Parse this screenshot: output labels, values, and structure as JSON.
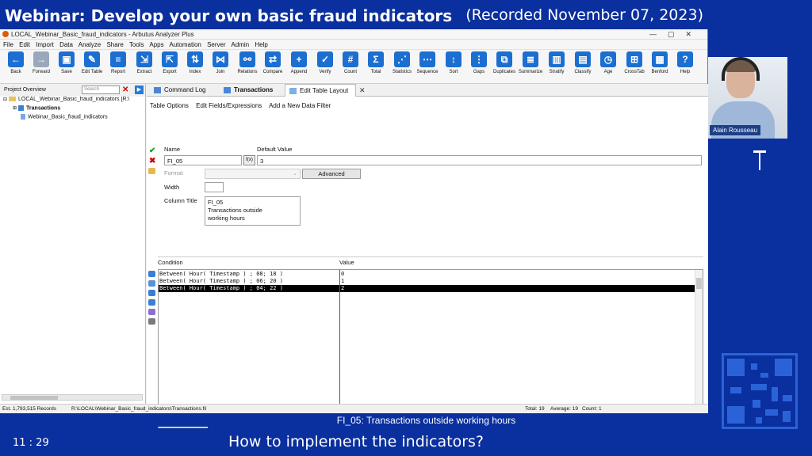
{
  "broadcast": {
    "title": "Webinar: Develop your own basic fraud indicators",
    "recorded": "(Recorded November 07, 2023)",
    "presenter": "Alain Rousseau",
    "time": "11 : 29",
    "caption": "FI_05: Transactions outside working hours",
    "subtitle": "How to implement the indicators?"
  },
  "window": {
    "title": "LOCAL_Webinar_Basic_fraud_indicators - Arbutus Analyzer Plus"
  },
  "menu": [
    "File",
    "Edit",
    "Import",
    "Data",
    "Analyze",
    "Share",
    "Tools",
    "Apps",
    "Automation",
    "Server",
    "Admin",
    "Help"
  ],
  "toolbar": [
    {
      "label": "Back",
      "icon": "back-arrow-icon",
      "color": "#1c6fd1",
      "glyph": "←"
    },
    {
      "label": "Forward",
      "icon": "forward-arrow-icon",
      "color": "#9aa8bb",
      "glyph": "→"
    },
    {
      "label": "Save",
      "icon": "save-icon",
      "color": "#1c6fd1",
      "glyph": "▣"
    },
    {
      "label": "Edit Table",
      "icon": "edit-table-icon",
      "color": "#1c6fd1",
      "glyph": "✎"
    },
    {
      "label": "Report",
      "icon": "report-icon",
      "color": "#1c6fd1",
      "glyph": "≡"
    },
    {
      "label": "Extract",
      "icon": "extract-icon",
      "color": "#1c6fd1",
      "glyph": "⇲"
    },
    {
      "label": "Export",
      "icon": "export-icon",
      "color": "#1c6fd1",
      "glyph": "⇱"
    },
    {
      "label": "Index",
      "icon": "index-icon",
      "color": "#1c6fd1",
      "glyph": "⇅"
    },
    {
      "label": "Join",
      "icon": "join-icon",
      "color": "#1c6fd1",
      "glyph": "⋈"
    },
    {
      "label": "Relations",
      "icon": "relations-icon",
      "color": "#1c6fd1",
      "glyph": "⚯"
    },
    {
      "label": "Compare",
      "icon": "compare-icon",
      "color": "#1c6fd1",
      "glyph": "⇄"
    },
    {
      "label": "Append",
      "icon": "append-icon",
      "color": "#1c6fd1",
      "glyph": "+"
    },
    {
      "label": "Verify",
      "icon": "verify-icon",
      "color": "#1c6fd1",
      "glyph": "✓"
    },
    {
      "label": "Count",
      "icon": "count-icon",
      "color": "#1c6fd1",
      "glyph": "#"
    },
    {
      "label": "Total",
      "icon": "total-icon",
      "color": "#1c6fd1",
      "glyph": "Σ"
    },
    {
      "label": "Statistics",
      "icon": "statistics-icon",
      "color": "#1c6fd1",
      "glyph": "⋰"
    },
    {
      "label": "Sequence",
      "icon": "sequence-icon",
      "color": "#1c6fd1",
      "glyph": "⋯"
    },
    {
      "label": "Sort",
      "icon": "sort-icon",
      "color": "#1c6fd1",
      "glyph": "↕"
    },
    {
      "label": "Gaps",
      "icon": "gaps-icon",
      "color": "#1c6fd1",
      "glyph": "⋮"
    },
    {
      "label": "Duplicates",
      "icon": "duplicates-icon",
      "color": "#1c6fd1",
      "glyph": "⧉"
    },
    {
      "label": "Summarize",
      "icon": "summarize-icon",
      "color": "#1c6fd1",
      "glyph": "≣"
    },
    {
      "label": "Stratify",
      "icon": "stratify-icon",
      "color": "#1c6fd1",
      "glyph": "▥"
    },
    {
      "label": "Classify",
      "icon": "classify-icon",
      "color": "#1c6fd1",
      "glyph": "▤"
    },
    {
      "label": "Age",
      "icon": "age-icon",
      "color": "#1c6fd1",
      "glyph": "◷"
    },
    {
      "label": "CrossTab",
      "icon": "crosstab-icon",
      "color": "#1c6fd1",
      "glyph": "⊞"
    },
    {
      "label": "Benford",
      "icon": "benford-icon",
      "color": "#1c6fd1",
      "glyph": "▦"
    },
    {
      "label": "Help",
      "icon": "help-icon",
      "color": "#1c6fd1",
      "glyph": "?"
    }
  ],
  "project": {
    "header": "Project Overview",
    "search_placeholder": "Search",
    "tree": [
      "LOCAL_Webinar_Basic_fraud_indicators [R:\\",
      "Transactions",
      "Webinar_Basic_fraud_indicators"
    ]
  },
  "tabs": [
    "Command Log",
    "Transactions",
    "Edit Table Layout"
  ],
  "layout_editor": {
    "subtabs": [
      "Table Options",
      "Edit Fields/Expressions",
      "Add a New Data Filter"
    ],
    "name_label": "Name",
    "name_value": "FI_05",
    "fx_label": "f(x)",
    "default_label": "Default Value",
    "default_value": "3",
    "format_label": "Format",
    "advanced_label": "Advanced",
    "width_label": "Width",
    "width_value": "",
    "column_title_label": "Column Title",
    "column_title": [
      "FI_05",
      "Transactions outside",
      "working hours"
    ],
    "condition_header": "Condition",
    "value_header": "Value",
    "rows": [
      {
        "condition": "Between( Hour( Timestamp ) ; 08; 18 )",
        "value": "0"
      },
      {
        "condition": "Between( Hour( Timestamp ) ; 06; 20 )",
        "value": "1"
      },
      {
        "condition": "Between( Hour( Timestamp ) ; 04; 22 )",
        "value": "2"
      }
    ]
  },
  "status": {
    "records": "Est. 1,793,515 Records",
    "path": "R:\\LOCAL\\Webinar_Basic_fraud_indicators\\Transactions.fil",
    "total": "Total: 19",
    "average": "Average: 19",
    "count": "Count: 1"
  }
}
